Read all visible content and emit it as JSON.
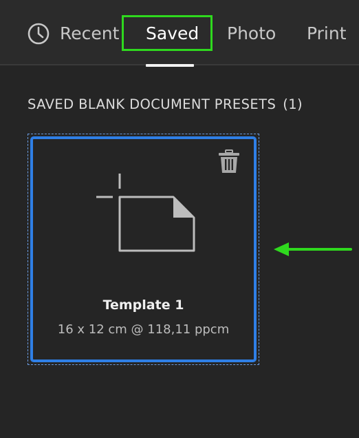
{
  "tabs": {
    "recent": "Recent",
    "saved": "Saved",
    "photo": "Photo",
    "print": "Print",
    "active": "Saved"
  },
  "section": {
    "title": "SAVED BLANK DOCUMENT PRESETS",
    "count": "(1)"
  },
  "presets": [
    {
      "name": "Template 1",
      "size": "16 x 12 cm @ 118,11 ppcm"
    }
  ],
  "icons": {
    "recent": "clock-icon",
    "delete": "trash-icon",
    "preset": "blank-document-icon",
    "annotation": "arrow-left-icon"
  },
  "colors": {
    "background": "#252525",
    "tabbar": "#2b2b2b",
    "selection": "#2f7fe6",
    "annotation": "#2fd91e"
  }
}
